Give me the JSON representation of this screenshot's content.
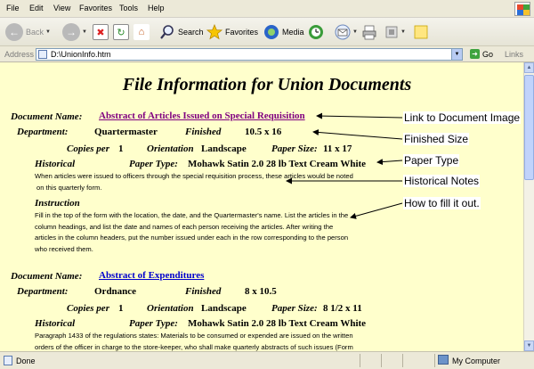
{
  "menu": [
    "File",
    "Edit",
    "View",
    "Favorites",
    "Tools",
    "Help"
  ],
  "toolbar": {
    "back_label": "Back",
    "search_label": "Search",
    "favorites_label": "Favorites",
    "media_label": "Media"
  },
  "address": {
    "label": "Address",
    "url": "D:\\UnionInfo.htm",
    "go_label": "Go",
    "links_label": "Links"
  },
  "page": {
    "title": "File Information for Union Documents",
    "labels": {
      "document_name": "Document Name:",
      "department": "Department:",
      "finished": "Finished",
      "copies_per": "Copies per",
      "orientation": "Orientation",
      "paper_size": "Paper Size:",
      "historical": "Historical",
      "paper_type": "Paper Type:",
      "instruction": "Instruction"
    },
    "documents": [
      {
        "name": "Abstract of Articles Issued on Special Requisition",
        "department": "Quartermaster",
        "finished": "10.5 x 16",
        "copies": "1",
        "orientation": "Landscape",
        "paper_size": "11 x 17",
        "paper_type": "Mohawk Satin 2.0 28 lb Text Cream White",
        "historical_lines": [
          "When articles were issued to officers through the special requisition process, these articles would be noted",
          "on this quarterly form."
        ],
        "instruction_lines": [
          "Fill in the top of the form with the location, the date, and the Quartermaster's name. List the articles in the",
          "column headings, and list the date and names of each person receiving the articles. After writing the",
          "articles in the column headers, put the number issued under each in the row corresponding to the person",
          "who received them."
        ]
      },
      {
        "name": "Abstract of Expenditures",
        "department": "Ordnance",
        "finished": "8 x 10.5",
        "copies": "1",
        "orientation": "Landscape",
        "paper_size": "8 1/2 x 11",
        "paper_type": "Mohawk Satin 2.0 28 lb Text Cream White",
        "historical_lines": [
          "Paragraph 1433 of the regulations states: Materials to be consumed or expended are issued on the written",
          "orders of the officer in charge to the store-keeper, who shall make quarterly abstracts of such issues (Form"
        ]
      }
    ]
  },
  "annotations": [
    "Link to Document Image",
    "Finished Size",
    "Paper Type",
    "Historical Notes",
    "How to fill it out."
  ],
  "status": {
    "text": "Done",
    "zone": "My Computer"
  },
  "colors": {
    "page_background": "#ffffcc",
    "visited_link": "#800080",
    "unvisited_link": "#0000cc"
  }
}
